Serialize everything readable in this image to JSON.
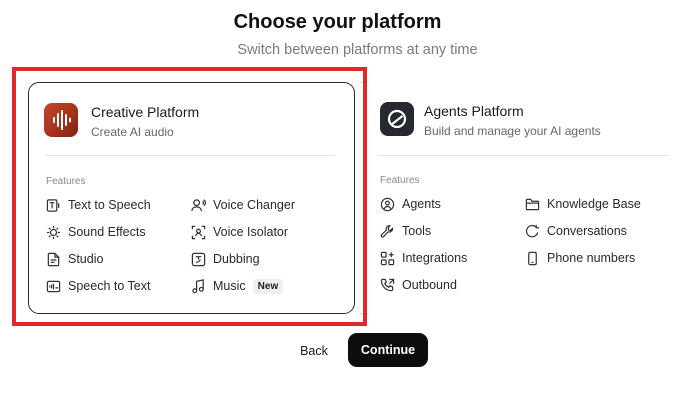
{
  "header": {
    "title": "Choose your platform",
    "subtitle": "Switch between platforms at any time"
  },
  "platforms": [
    {
      "name": "Creative Platform",
      "description": "Create AI audio",
      "icon": "waveform-icon",
      "selected": true,
      "features_label": "Features",
      "features": [
        {
          "label": "Text to Speech",
          "icon": "text-to-speech-icon"
        },
        {
          "label": "Voice Changer",
          "icon": "voice-changer-icon"
        },
        {
          "label": "Sound Effects",
          "icon": "sound-effects-icon"
        },
        {
          "label": "Voice Isolator",
          "icon": "voice-isolator-icon"
        },
        {
          "label": "Studio",
          "icon": "studio-icon"
        },
        {
          "label": "Dubbing",
          "icon": "dubbing-icon"
        },
        {
          "label": "Speech to Text",
          "icon": "speech-to-text-icon"
        },
        {
          "label": "Music",
          "icon": "music-icon",
          "badge": "New"
        }
      ]
    },
    {
      "name": "Agents Platform",
      "description": "Build and manage your AI agents",
      "icon": "agents-logo-icon",
      "selected": false,
      "features_label": "Features",
      "features": [
        {
          "label": "Agents",
          "icon": "agents-icon"
        },
        {
          "label": "Knowledge Base",
          "icon": "knowledge-base-icon"
        },
        {
          "label": "Tools",
          "icon": "tools-icon"
        },
        {
          "label": "Conversations",
          "icon": "conversations-icon"
        },
        {
          "label": "Integrations",
          "icon": "integrations-icon"
        },
        {
          "label": "Phone numbers",
          "icon": "phone-numbers-icon"
        },
        {
          "label": "Outbound",
          "icon": "outbound-icon"
        }
      ]
    }
  ],
  "actions": {
    "back_label": "Back",
    "continue_label": "Continue"
  },
  "colors": {
    "highlight": "#e02a2a",
    "creative_icon": "#b63b24",
    "agents_icon": "#262a30",
    "primary_button": "#0d0d0d"
  }
}
